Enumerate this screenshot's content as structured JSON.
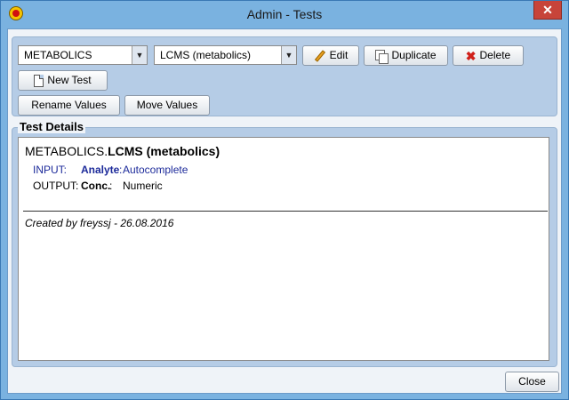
{
  "window": {
    "title": "Admin - Tests",
    "close_glyph": "✕"
  },
  "toolbar": {
    "category_select": "METABOLICS",
    "test_select": "LCMS (metabolics)",
    "edit_label": "Edit",
    "duplicate_label": "Duplicate",
    "delete_label": "Delete",
    "new_test_label": "New Test",
    "rename_values_label": "Rename Values",
    "move_values_label": "Move Values"
  },
  "details": {
    "legend": "Test Details",
    "test_prefix": "METABOLICS.",
    "test_name": "LCMS (metabolics)",
    "input_label": "INPUT:",
    "input_field": "Analyte",
    "input_sep": ":",
    "input_type": "Autocomplete",
    "output_label": "OUTPUT:",
    "output_field": "Conc.",
    "output_sep": ":",
    "output_type": "Numeric",
    "credit": "Created by freyssj - 26.08.2016"
  },
  "footer": {
    "close_label": "Close"
  },
  "colors": {
    "accent_blue": "#1c2a9a",
    "title_bar": "#7ab2e0",
    "panel": "#b5cce6",
    "close_red": "#c7443a"
  },
  "icons": [
    "app-icon",
    "pencil-icon",
    "duplicate-icon",
    "delete-icon",
    "new-doc-icon",
    "close-icon",
    "dropdown-arrow-icon"
  ]
}
